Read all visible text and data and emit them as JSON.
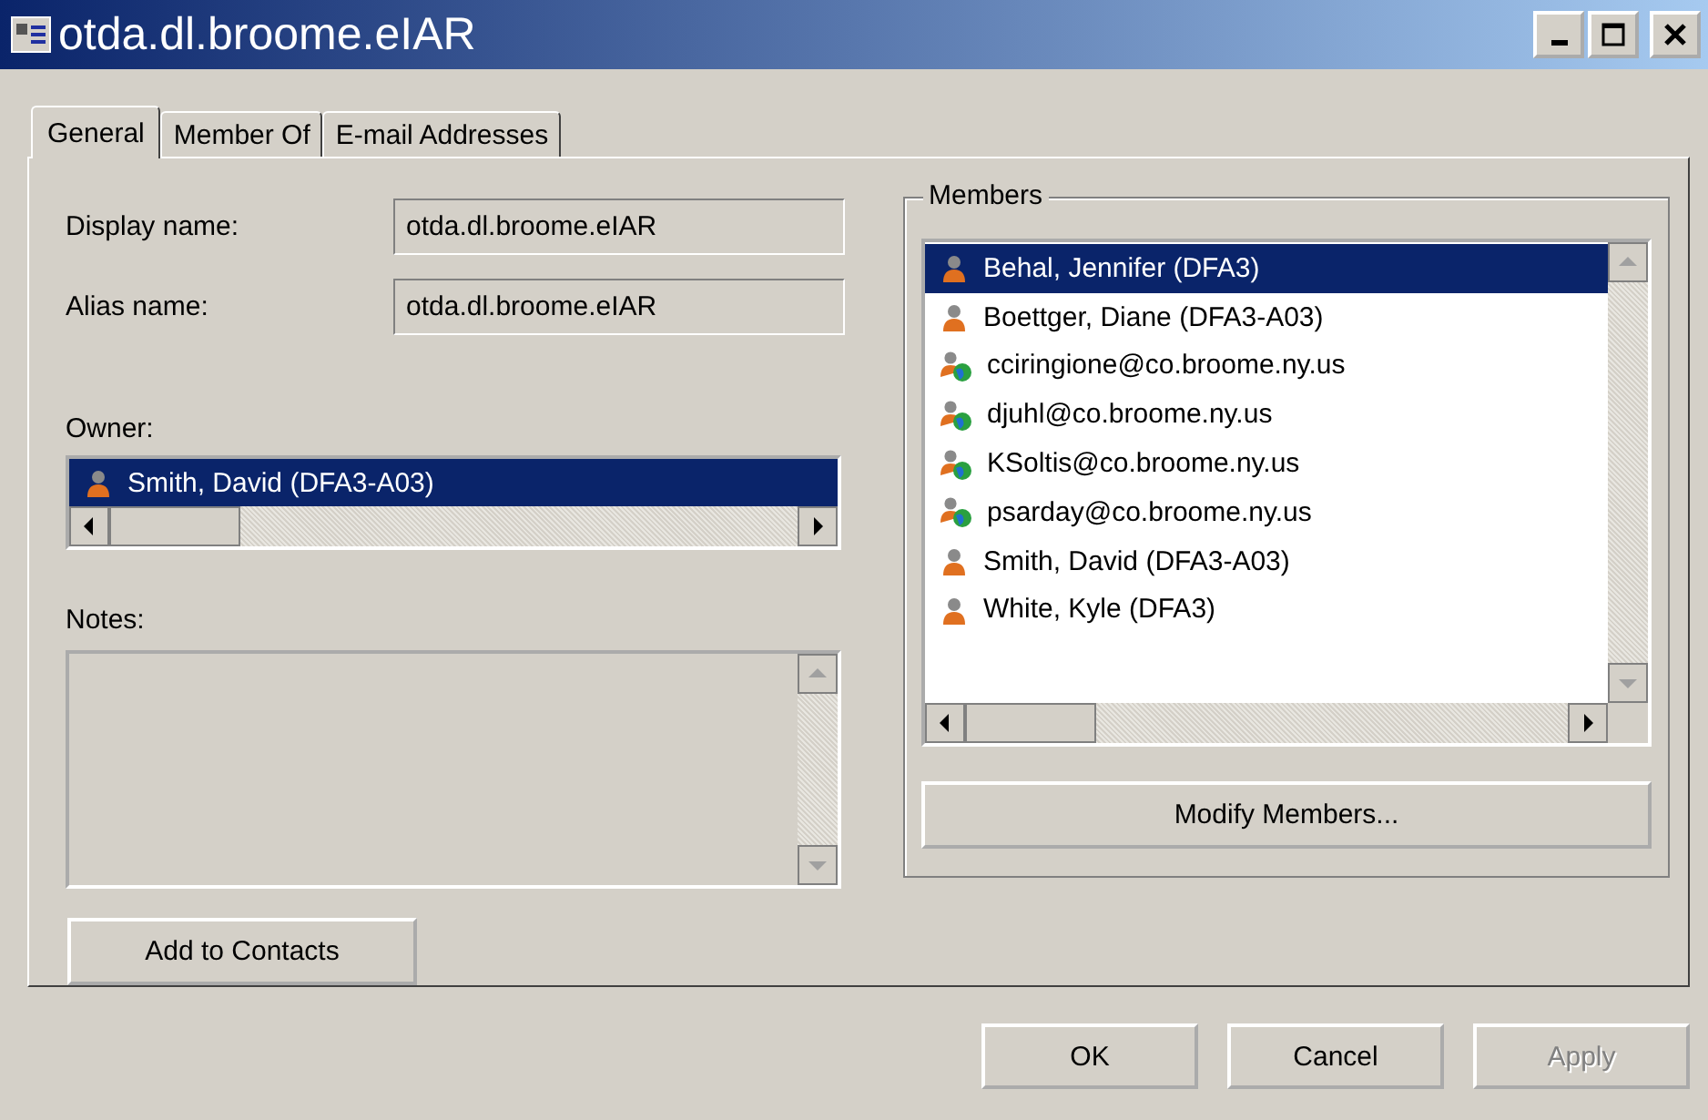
{
  "window": {
    "title": "otda.dl.broome.eIAR"
  },
  "tabs": [
    {
      "label": "General",
      "selected": true
    },
    {
      "label": "Member Of",
      "selected": false
    },
    {
      "label": "E-mail Addresses",
      "selected": false
    }
  ],
  "fields": [
    {
      "label": "Display name:",
      "value": "otda.dl.broome.eIAR"
    },
    {
      "label": "Alias name:",
      "value": "otda.dl.broome.eIAR"
    }
  ],
  "owner": {
    "label": "Owner:",
    "items": [
      {
        "name": "Smith, David (DFA3-A03)",
        "selected": true
      }
    ]
  },
  "notes": {
    "label": "Notes:"
  },
  "add_button": "Add to Contacts",
  "members": {
    "title": "Members",
    "button": "Modify Members...",
    "items": [
      {
        "name": "Behal, Jennifer (DFA3)",
        "kind": "user",
        "selected": true
      },
      {
        "name": "Boettger, Diane (DFA3-A03)",
        "kind": "user",
        "selected": false
      },
      {
        "name": "cciringione@co.broome.ny.us",
        "kind": "contact",
        "selected": false
      },
      {
        "name": "djuhl@co.broome.ny.us",
        "kind": "contact",
        "selected": false
      },
      {
        "name": "KSoltis@co.broome.ny.us",
        "kind": "contact",
        "selected": false
      },
      {
        "name": "psarday@co.broome.ny.us",
        "kind": "contact",
        "selected": false
      },
      {
        "name": "Smith, David (DFA3-A03)",
        "kind": "user",
        "selected": false
      },
      {
        "name": "White, Kyle (DFA3)",
        "kind": "user",
        "selected": false
      }
    ]
  },
  "buttons": [
    {
      "label": "OK",
      "disabled": false
    },
    {
      "label": "Cancel",
      "disabled": false
    },
    {
      "label": "Apply",
      "disabled": true
    }
  ]
}
